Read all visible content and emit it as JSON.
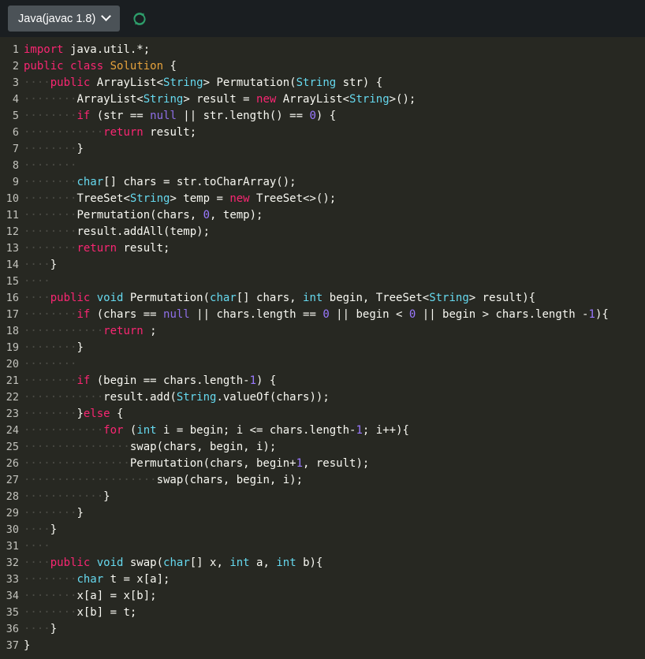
{
  "toolbar": {
    "language_label": "Java(javac 1.8)",
    "chevron_icon": "chevron-down-icon",
    "refresh_icon": "refresh-icon",
    "refresh_color": "#2e9e6b",
    "background": "#1a1e21",
    "select_background": "#4b5257"
  },
  "editor": {
    "background": "#272822",
    "language": "java",
    "line_count": 37,
    "gutter_color": "#c3c3bd",
    "colors": {
      "keyword": "#f92672",
      "type": "#66d9ef",
      "class_name": "#e6a23c",
      "number": "#9a79ff",
      "plain": "#f8f8f2",
      "indent_guide": "#4a4a44"
    },
    "lines": [
      {
        "n": "1",
        "tokens": [
          {
            "t": "import",
            "c": "kw"
          },
          {
            "t": " java.util.*;",
            "c": "pln"
          }
        ]
      },
      {
        "n": "2",
        "tokens": [
          {
            "t": "public",
            "c": "kw"
          },
          {
            "t": " ",
            "c": "pln"
          },
          {
            "t": "class",
            "c": "kw"
          },
          {
            "t": " ",
            "c": "pln"
          },
          {
            "t": "Solution",
            "c": "cls"
          },
          {
            "t": " {",
            "c": "pln"
          }
        ]
      },
      {
        "n": "3",
        "tokens": [
          {
            "t": "····",
            "c": "ind"
          },
          {
            "t": "public",
            "c": "kw"
          },
          {
            "t": " ArrayList<",
            "c": "pln"
          },
          {
            "t": "String",
            "c": "typ"
          },
          {
            "t": "> Permutation(",
            "c": "pln"
          },
          {
            "t": "String",
            "c": "typ"
          },
          {
            "t": " str) {",
            "c": "pln"
          }
        ]
      },
      {
        "n": "4",
        "tokens": [
          {
            "t": "········",
            "c": "ind"
          },
          {
            "t": "ArrayList<",
            "c": "pln"
          },
          {
            "t": "String",
            "c": "typ"
          },
          {
            "t": "> result = ",
            "c": "pln"
          },
          {
            "t": "new",
            "c": "kw"
          },
          {
            "t": " ArrayList<",
            "c": "pln"
          },
          {
            "t": "String",
            "c": "typ"
          },
          {
            "t": ">();",
            "c": "pln"
          }
        ]
      },
      {
        "n": "5",
        "tokens": [
          {
            "t": "········",
            "c": "ind"
          },
          {
            "t": "if",
            "c": "kw"
          },
          {
            "t": " (str == ",
            "c": "pln"
          },
          {
            "t": "null",
            "c": "nul"
          },
          {
            "t": " || str.length() == ",
            "c": "pln"
          },
          {
            "t": "0",
            "c": "num"
          },
          {
            "t": ") {",
            "c": "pln"
          }
        ]
      },
      {
        "n": "6",
        "tokens": [
          {
            "t": "············",
            "c": "ind"
          },
          {
            "t": "return",
            "c": "kw"
          },
          {
            "t": " result;",
            "c": "pln"
          }
        ]
      },
      {
        "n": "7",
        "tokens": [
          {
            "t": "········",
            "c": "ind"
          },
          {
            "t": "}",
            "c": "pln"
          }
        ]
      },
      {
        "n": "8",
        "tokens": [
          {
            "t": "········",
            "c": "ind"
          }
        ]
      },
      {
        "n": "9",
        "tokens": [
          {
            "t": "········",
            "c": "ind"
          },
          {
            "t": "char",
            "c": "typ"
          },
          {
            "t": "[] chars = str.toCharArray();",
            "c": "pln"
          }
        ]
      },
      {
        "n": "10",
        "tokens": [
          {
            "t": "········",
            "c": "ind"
          },
          {
            "t": "TreeSet<",
            "c": "pln"
          },
          {
            "t": "String",
            "c": "typ"
          },
          {
            "t": "> temp = ",
            "c": "pln"
          },
          {
            "t": "new",
            "c": "kw"
          },
          {
            "t": " TreeSet<>();",
            "c": "pln"
          }
        ]
      },
      {
        "n": "11",
        "tokens": [
          {
            "t": "········",
            "c": "ind"
          },
          {
            "t": "Permutation(chars, ",
            "c": "pln"
          },
          {
            "t": "0",
            "c": "num"
          },
          {
            "t": ", temp);",
            "c": "pln"
          }
        ]
      },
      {
        "n": "12",
        "tokens": [
          {
            "t": "········",
            "c": "ind"
          },
          {
            "t": "result.addAll(temp);",
            "c": "pln"
          }
        ]
      },
      {
        "n": "13",
        "tokens": [
          {
            "t": "········",
            "c": "ind"
          },
          {
            "t": "return",
            "c": "kw"
          },
          {
            "t": " result;",
            "c": "pln"
          }
        ]
      },
      {
        "n": "14",
        "tokens": [
          {
            "t": "····",
            "c": "ind"
          },
          {
            "t": "}",
            "c": "pln"
          }
        ]
      },
      {
        "n": "15",
        "tokens": [
          {
            "t": "····",
            "c": "ind"
          }
        ]
      },
      {
        "n": "16",
        "tokens": [
          {
            "t": "····",
            "c": "ind"
          },
          {
            "t": "public",
            "c": "kw"
          },
          {
            "t": " ",
            "c": "pln"
          },
          {
            "t": "void",
            "c": "typ"
          },
          {
            "t": " Permutation(",
            "c": "pln"
          },
          {
            "t": "char",
            "c": "typ"
          },
          {
            "t": "[] chars, ",
            "c": "pln"
          },
          {
            "t": "int",
            "c": "typ"
          },
          {
            "t": " begin, TreeSet<",
            "c": "pln"
          },
          {
            "t": "String",
            "c": "typ"
          },
          {
            "t": "> result){",
            "c": "pln"
          }
        ]
      },
      {
        "n": "17",
        "tokens": [
          {
            "t": "········",
            "c": "ind"
          },
          {
            "t": "if",
            "c": "kw"
          },
          {
            "t": " (chars == ",
            "c": "pln"
          },
          {
            "t": "null",
            "c": "nul"
          },
          {
            "t": " || chars.length == ",
            "c": "pln"
          },
          {
            "t": "0",
            "c": "num"
          },
          {
            "t": " || begin < ",
            "c": "pln"
          },
          {
            "t": "0",
            "c": "num"
          },
          {
            "t": " || begin > chars.length -",
            "c": "pln"
          },
          {
            "t": "1",
            "c": "num"
          },
          {
            "t": "){",
            "c": "pln"
          }
        ]
      },
      {
        "n": "18",
        "tokens": [
          {
            "t": "············",
            "c": "ind"
          },
          {
            "t": "return",
            "c": "kw"
          },
          {
            "t": " ;",
            "c": "pln"
          }
        ]
      },
      {
        "n": "19",
        "tokens": [
          {
            "t": "········",
            "c": "ind"
          },
          {
            "t": "}",
            "c": "pln"
          }
        ]
      },
      {
        "n": "20",
        "tokens": [
          {
            "t": "········",
            "c": "ind"
          }
        ]
      },
      {
        "n": "21",
        "tokens": [
          {
            "t": "········",
            "c": "ind"
          },
          {
            "t": "if",
            "c": "kw"
          },
          {
            "t": " (begin == chars.length-",
            "c": "pln"
          },
          {
            "t": "1",
            "c": "num"
          },
          {
            "t": ") {",
            "c": "pln"
          }
        ]
      },
      {
        "n": "22",
        "tokens": [
          {
            "t": "············",
            "c": "ind"
          },
          {
            "t": "result.add(",
            "c": "pln"
          },
          {
            "t": "String",
            "c": "typ"
          },
          {
            "t": ".valueOf(chars));",
            "c": "pln"
          }
        ]
      },
      {
        "n": "23",
        "tokens": [
          {
            "t": "········",
            "c": "ind"
          },
          {
            "t": "}",
            "c": "pln"
          },
          {
            "t": "else",
            "c": "kw"
          },
          {
            "t": " {",
            "c": "pln"
          }
        ]
      },
      {
        "n": "24",
        "tokens": [
          {
            "t": "············",
            "c": "ind"
          },
          {
            "t": "for",
            "c": "kw"
          },
          {
            "t": " (",
            "c": "pln"
          },
          {
            "t": "int",
            "c": "typ"
          },
          {
            "t": " i = begin; i <= chars.length-",
            "c": "pln"
          },
          {
            "t": "1",
            "c": "num"
          },
          {
            "t": "; i++){",
            "c": "pln"
          }
        ]
      },
      {
        "n": "25",
        "tokens": [
          {
            "t": "················",
            "c": "ind"
          },
          {
            "t": "swap(chars, begin, i);",
            "c": "pln"
          }
        ]
      },
      {
        "n": "26",
        "tokens": [
          {
            "t": "················",
            "c": "ind"
          },
          {
            "t": "Permutation(chars, begin+",
            "c": "pln"
          },
          {
            "t": "1",
            "c": "num"
          },
          {
            "t": ", result);",
            "c": "pln"
          }
        ]
      },
      {
        "n": "27",
        "tokens": [
          {
            "t": "····················",
            "c": "ind"
          },
          {
            "t": "swap(chars, begin, i);",
            "c": "pln"
          }
        ]
      },
      {
        "n": "28",
        "tokens": [
          {
            "t": "············",
            "c": "ind"
          },
          {
            "t": "}",
            "c": "pln"
          }
        ]
      },
      {
        "n": "29",
        "tokens": [
          {
            "t": "········",
            "c": "ind"
          },
          {
            "t": "}",
            "c": "pln"
          }
        ]
      },
      {
        "n": "30",
        "tokens": [
          {
            "t": "····",
            "c": "ind"
          },
          {
            "t": "}",
            "c": "pln"
          }
        ]
      },
      {
        "n": "31",
        "tokens": [
          {
            "t": "····",
            "c": "ind"
          }
        ]
      },
      {
        "n": "32",
        "tokens": [
          {
            "t": "····",
            "c": "ind"
          },
          {
            "t": "public",
            "c": "kw"
          },
          {
            "t": " ",
            "c": "pln"
          },
          {
            "t": "void",
            "c": "typ"
          },
          {
            "t": " swap(",
            "c": "pln"
          },
          {
            "t": "char",
            "c": "typ"
          },
          {
            "t": "[] x, ",
            "c": "pln"
          },
          {
            "t": "int",
            "c": "typ"
          },
          {
            "t": " a, ",
            "c": "pln"
          },
          {
            "t": "int",
            "c": "typ"
          },
          {
            "t": " b){",
            "c": "pln"
          }
        ]
      },
      {
        "n": "33",
        "tokens": [
          {
            "t": "········",
            "c": "ind"
          },
          {
            "t": "char",
            "c": "typ"
          },
          {
            "t": " t = x[a];",
            "c": "pln"
          }
        ]
      },
      {
        "n": "34",
        "tokens": [
          {
            "t": "········",
            "c": "ind"
          },
          {
            "t": "x[a] = x[b];",
            "c": "pln"
          }
        ]
      },
      {
        "n": "35",
        "tokens": [
          {
            "t": "········",
            "c": "ind"
          },
          {
            "t": "x[b] = t;",
            "c": "pln"
          }
        ]
      },
      {
        "n": "36",
        "tokens": [
          {
            "t": "····",
            "c": "ind"
          },
          {
            "t": "}",
            "c": "pln"
          }
        ]
      },
      {
        "n": "37",
        "tokens": [
          {
            "t": "}",
            "c": "pln"
          }
        ]
      }
    ]
  }
}
